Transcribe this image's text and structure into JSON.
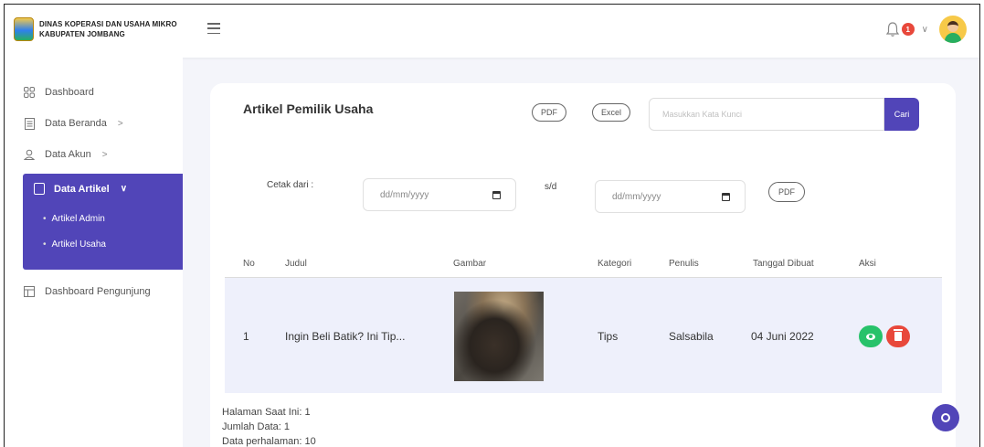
{
  "brand": {
    "line1": "DINAS KOPERASI DAN USAHA MIKRO",
    "line2": "KABUPATEN JOMBANG",
    "logo_colors": [
      "#f2c94c",
      "#2f80ed",
      "#27ae60"
    ]
  },
  "header": {
    "notification_count": "1",
    "icons": [
      "hamburger-icon",
      "bell-icon",
      "chevron-down-icon",
      "avatar"
    ]
  },
  "sidebar": {
    "items": [
      {
        "label": "Dashboard",
        "icon": "grid-icon"
      },
      {
        "label": "Data Beranda",
        "icon": "document-icon",
        "arrow": ">"
      },
      {
        "label": "Data Akun",
        "icon": "user-icon",
        "arrow": ">"
      },
      {
        "label": "Data Artikel",
        "icon": "article-icon",
        "arrow": "∨",
        "active": true,
        "children": [
          {
            "label": "Artikel Admin"
          },
          {
            "label": "Artikel Usaha",
            "active": true
          }
        ]
      },
      {
        "label": "Dashboard Pengunjung",
        "icon": "table-icon"
      }
    ]
  },
  "main": {
    "title": "Artikel Pemilik Usaha",
    "export_pdf": "PDF",
    "export_excel": "Excel",
    "search_placeholder": "Masukkan Kata Kunci",
    "search_button": "Cari",
    "print_from_label": "Cetak dari :",
    "date_from_placeholder": "dd/mm/yyyy",
    "to_label": "s/d",
    "date_to_placeholder": "dd/mm/yyyy",
    "print_pdf": "PDF"
  },
  "table": {
    "headers": [
      "No",
      "Judul",
      "Gambar",
      "Kategori",
      "Penulis",
      "Tanggal Dibuat",
      "Aksi"
    ],
    "rows": [
      {
        "no": "1",
        "judul": "Ingin Beli Batik? Ini Tip...",
        "kategori": "Tips",
        "penulis": "Salsabila",
        "tanggal": "04 Juni 2022"
      }
    ]
  },
  "pagination": {
    "current_page": "Halaman Saat Ini: 1",
    "total_data": "Jumlah Data: 1",
    "per_page": "Data perhalaman: 10"
  },
  "colors": {
    "accent": "#5145b8",
    "view_button": "#27c26a",
    "delete_button": "#e8483b",
    "row_highlight": "#eef0fb"
  }
}
